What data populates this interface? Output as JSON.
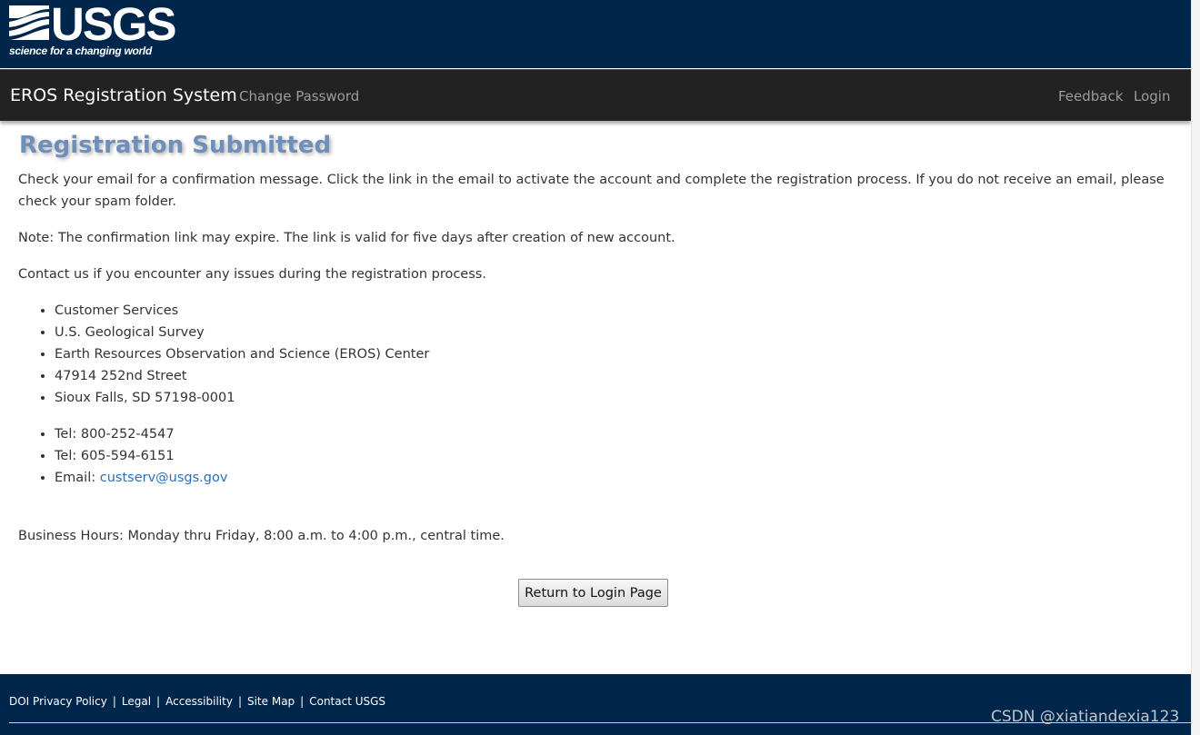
{
  "header": {
    "logo": {
      "word": "USGS",
      "tagline": "science for a changing world"
    }
  },
  "navbar": {
    "brand": "EROS Registration System",
    "links": {
      "change_password": "Change Password",
      "feedback": "Feedback",
      "login": "Login"
    }
  },
  "main": {
    "title": "Registration Submitted",
    "paragraphs": [
      "Check your email for a confirmation message. Click the link in the email to activate the account and complete the registration process. If you do not receive an email, please check your spam folder.",
      "Note: The confirmation link may expire. The link is valid for five days after creation of new account.",
      "Contact us if you encounter any issues during the registration process."
    ],
    "address": [
      "Customer Services",
      "U.S. Geological Survey",
      "Earth Resources Observation and Science (EROS) Center",
      "47914 252nd Street",
      "Sioux Falls, SD 57198-0001"
    ],
    "contact": {
      "tel1": "Tel: 800-252-4547",
      "tel2": "Tel: 605-594-6151",
      "email_label": "Email: ",
      "email": "custserv@usgs.gov"
    },
    "business_hours": "Business Hours: Monday thru Friday, 8:00 a.m. to 4:00 p.m., central time.",
    "return_button": "Return to Login Page"
  },
  "footer": {
    "links": [
      "DOI Privacy Policy",
      "Legal",
      "Accessibility",
      "Site Map",
      "Contact USGS"
    ],
    "separator": "|"
  },
  "watermark": "CSDN @xiatiandexia123"
}
